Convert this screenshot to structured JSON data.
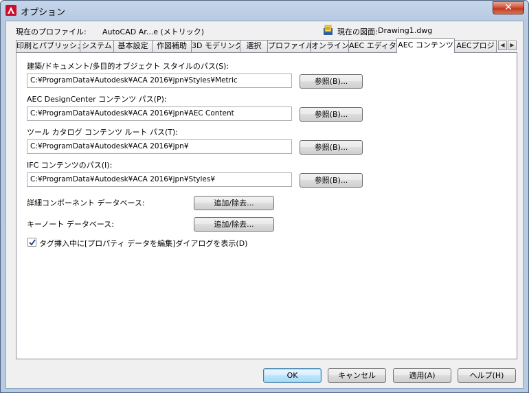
{
  "window": {
    "title": "オプション",
    "close_glyph": "✕"
  },
  "profile": {
    "current_profile_label": "現在のプロファイル:",
    "current_profile_value": "AutoCAD Ar...e (メトリック)",
    "current_drawing_label": "現在の図面:",
    "current_drawing_value": "Drawing1.dwg"
  },
  "tabs": [
    {
      "label": "印刷とパブリッシュ",
      "active": false
    },
    {
      "label": "システム",
      "active": false
    },
    {
      "label": "基本設定",
      "active": false
    },
    {
      "label": "作図補助",
      "active": false
    },
    {
      "label": "3D モデリング",
      "active": false
    },
    {
      "label": "選択",
      "active": false
    },
    {
      "label": "プロファイル",
      "active": false
    },
    {
      "label": "オンライン",
      "active": false
    },
    {
      "label": "AEC エディタ",
      "active": false
    },
    {
      "label": "AEC コンテンツ",
      "active": true
    },
    {
      "label": "AECプロジ",
      "active": false
    }
  ],
  "tab_scroll": {
    "left": "◀",
    "right": "▶"
  },
  "content": {
    "styles_path": {
      "label": "建築/ドキュメント/多目的オブジェクト スタイルのパス(S):",
      "value": "C:¥ProgramData¥Autodesk¥ACA 2016¥jpn¥Styles¥Metric",
      "browse": "参照(B)..."
    },
    "designcenter_path": {
      "label": "AEC DesignCenter コンテンツ パス(P):",
      "value": "C:¥ProgramData¥Autodesk¥ACA 2016¥jpn¥AEC Content",
      "browse": "参照(B)..."
    },
    "tool_catalog_path": {
      "label": "ツール カタログ コンテンツ ルート パス(T):",
      "value": "C:¥ProgramData¥Autodesk¥ACA 2016¥jpn¥",
      "browse": "参照(B)..."
    },
    "ifc_path": {
      "label": "IFC コンテンツのパス(I):",
      "value": "C:¥ProgramData¥Autodesk¥ACA 2016¥jpn¥Styles¥",
      "browse": "参照(B)..."
    },
    "detail_db": {
      "label": "詳細コンポーネント データベース:",
      "button": "追加/除去..."
    },
    "keynote_db": {
      "label": "キーノート データベース:",
      "button": "追加/除去..."
    },
    "show_edit_dialog": {
      "label": "タグ挿入中に[プロパティ データを編集]ダイアログを表示(D)",
      "checked": true
    }
  },
  "footer": {
    "ok": "OK",
    "cancel": "キャンセル",
    "apply": "適用(A)",
    "help": "ヘルプ(H)"
  }
}
